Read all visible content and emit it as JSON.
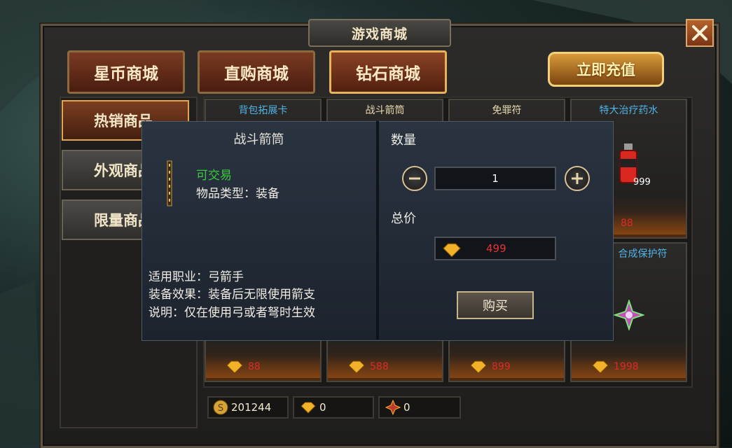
{
  "window": {
    "title": "游戏商城",
    "close_label": "✕"
  },
  "tabs": [
    {
      "label": "星币商城"
    },
    {
      "label": "直购商城"
    },
    {
      "label": "钻石商城"
    }
  ],
  "recharge_label": "立即充值",
  "sidebar": [
    {
      "label": "热销商品"
    },
    {
      "label": "外观商品"
    },
    {
      "label": "限量商品"
    }
  ],
  "items_top": [
    {
      "name": "背包拓展卡",
      "price": "",
      "color": "#4fb4e8"
    },
    {
      "name": "战斗箭筒",
      "price": "",
      "color": "#e9e4d8"
    },
    {
      "name": "免罪符",
      "price": "",
      "color": "#e9e4d8"
    },
    {
      "name": "特大治疗药水",
      "price": "88",
      "color": "#4fb4e8",
      "count": "999"
    }
  ],
  "items_bottom": [
    {
      "name": "",
      "price": "88"
    },
    {
      "name": "",
      "price": "588"
    },
    {
      "name": "",
      "price": "899"
    },
    {
      "name": "合成保护符",
      "price": "1998",
      "color": "#4fb4e8"
    }
  ],
  "currency": {
    "coins": "201244",
    "diamonds": "0",
    "tokens": "0"
  },
  "popup": {
    "item_title": "战斗箭筒",
    "tradable": "可交易",
    "item_type": "物品类型：装备",
    "job": "适用职业：弓箭手",
    "effect": "装备效果：装备后无限使用箭支",
    "note": "说明：仅在使用弓或者弩时生效",
    "qty_label": "数量",
    "qty_value": "1",
    "total_label": "总价",
    "total_value": "499",
    "buy_label": "购买"
  },
  "colors": {
    "accent_gold": "#e6b35a",
    "price_red": "#d92b2b",
    "tradable_green": "#3cc93c",
    "link_blue": "#4fb4e8"
  }
}
